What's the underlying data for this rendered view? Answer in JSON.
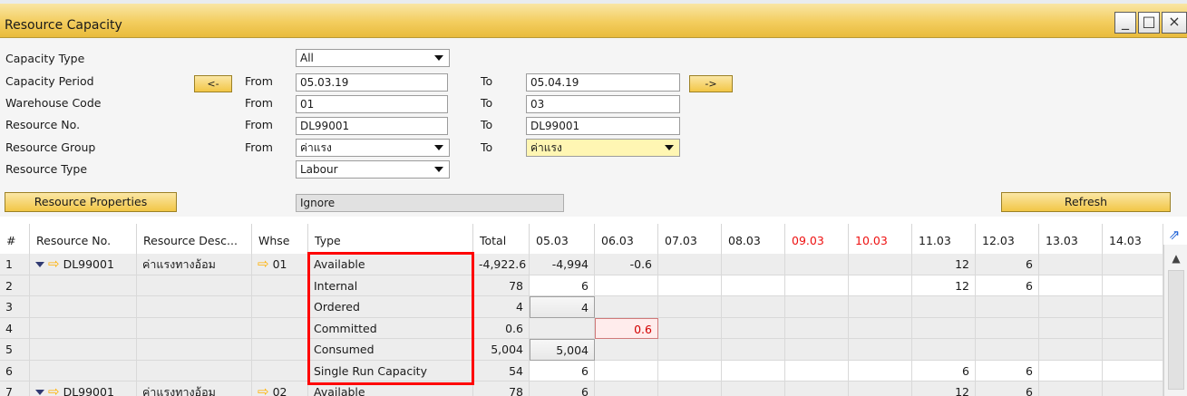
{
  "window": {
    "title": "Resource Capacity",
    "buttons": {
      "minimize": "_",
      "maximize": "□",
      "close": "×"
    }
  },
  "criteria": {
    "capacity_type": {
      "label": "Capacity Type",
      "value": "All"
    },
    "capacity_period": {
      "label": "Capacity Period",
      "prev": "<-",
      "next": "->",
      "from_label": "From",
      "from": "05.03.19",
      "to_label": "To",
      "to": "05.04.19"
    },
    "warehouse_code": {
      "label": "Warehouse Code",
      "from_label": "From",
      "from": "01",
      "to_label": "To",
      "to": "03"
    },
    "resource_no": {
      "label": "Resource No.",
      "from_label": "From",
      "from": "DL99001",
      "to_label": "To",
      "to": "DL99001"
    },
    "resource_group": {
      "label": "Resource Group",
      "from_label": "From",
      "from": "ค่าแรง",
      "to_label": "To",
      "to": "ค่าแรง"
    },
    "resource_type": {
      "label": "Resource Type",
      "value": "Labour"
    },
    "properties_button": "Resource Properties",
    "properties_value": "Ignore",
    "refresh_button": "Refresh"
  },
  "grid": {
    "headers": [
      "#",
      "Resource No.",
      "Resource Desc...",
      "Whse",
      "Type",
      "Total",
      "05.03",
      "06.03",
      "07.03",
      "08.03",
      "09.03",
      "10.03",
      "11.03",
      "12.03",
      "13.03",
      "14.03"
    ],
    "rows": [
      {
        "n": "1",
        "resource": "DL99001",
        "desc": "ค่าแรงทางอ้อม",
        "whse": "01",
        "type": "Available",
        "total": "-4,922.6",
        "d0503": "-4,994",
        "d0603": "-0.6",
        "d1103": "12",
        "d1203": "6"
      },
      {
        "n": "2",
        "type": "Internal",
        "total": "78",
        "d0503": "6",
        "d1103": "12",
        "d1203": "6"
      },
      {
        "n": "3",
        "type": "Ordered",
        "total": "4",
        "d0503": "4"
      },
      {
        "n": "4",
        "type": "Committed",
        "total": "0.6",
        "d0603": "0.6"
      },
      {
        "n": "5",
        "type": "Consumed",
        "total": "5,004",
        "d0503": "5,004"
      },
      {
        "n": "6",
        "type": "Single Run Capacity",
        "total": "54",
        "d0503": "6",
        "d1103": "6",
        "d1203": "6"
      },
      {
        "n": "7",
        "resource": "DL99001",
        "desc": "ค่าแรงทางอ้อม",
        "whse": "02",
        "type": "Available",
        "total": "78",
        "d0503": "6",
        "d1103": "12",
        "d1203": "6"
      }
    ]
  },
  "colors": {
    "accent": "#f3cd5e",
    "weekend_header": "#e11111",
    "highlight": "#ff0000"
  }
}
